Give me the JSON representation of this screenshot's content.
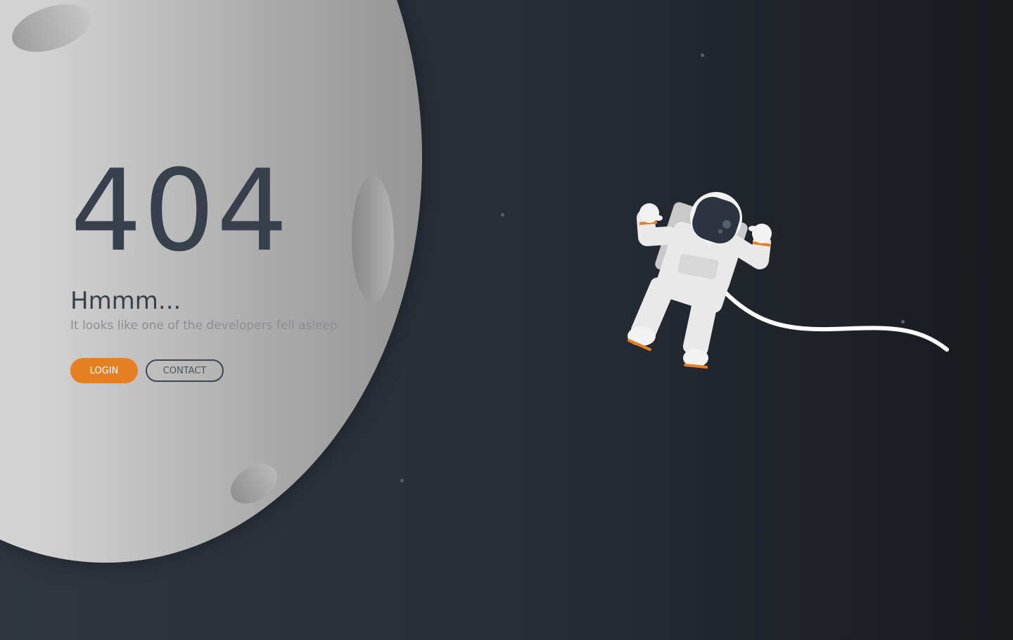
{
  "page": {
    "error_code": "404",
    "headline": "Hmmm...",
    "message": "It looks like one of the developers fell asleep"
  },
  "buttons": {
    "login_label": "LOGIN",
    "contact_label": "CONTACT"
  },
  "colors": {
    "background_left": "#2f3640",
    "background_right": "#181a1e",
    "moon_light": "#d2d2d2",
    "moon_dark": "#959595",
    "text_dark": "#38404c",
    "accent": "#e67e22",
    "suit": "#e9e9e9",
    "visor": "#2d3340"
  },
  "icons": {
    "astronaut": "astronaut-illustration",
    "moon": "moon-illustration"
  }
}
